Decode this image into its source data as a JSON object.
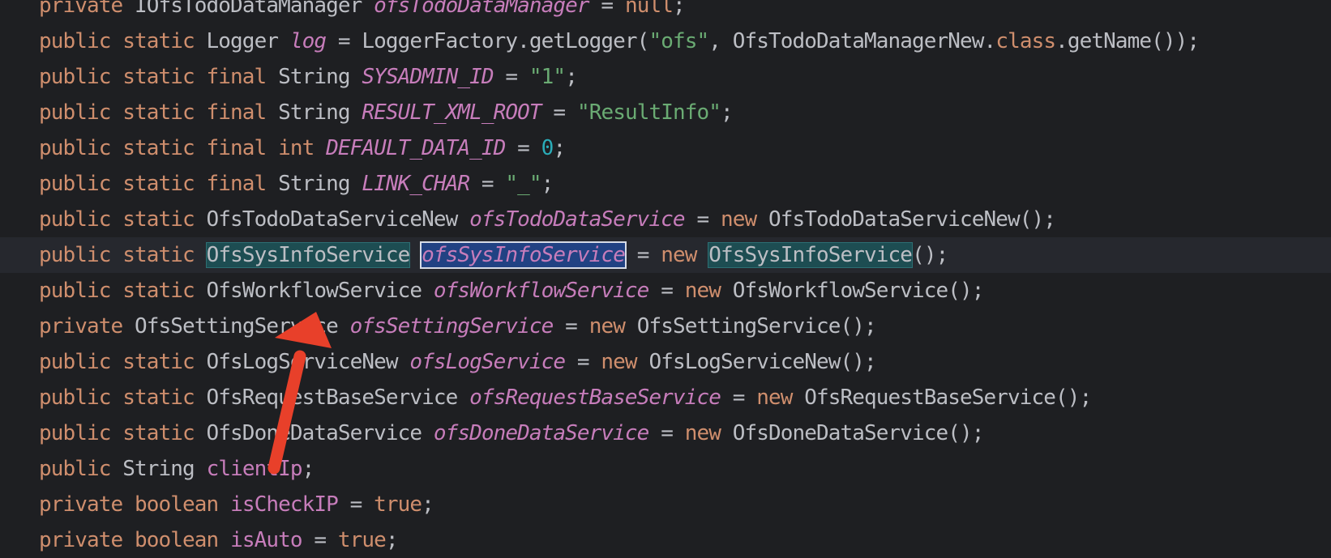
{
  "editor": {
    "lines": [
      {
        "segments": [
          {
            "t": "private",
            "c": "kw"
          },
          {
            "t": " IOfsTodoDataManager ",
            "c": "cls"
          },
          {
            "t": "ofsTodoDataManager",
            "c": "fld"
          },
          {
            "t": " = ",
            "c": "cls"
          },
          {
            "t": "null",
            "c": "kw"
          },
          {
            "t": ";",
            "c": "cls"
          }
        ]
      },
      {
        "segments": [
          {
            "t": "public static",
            "c": "kw"
          },
          {
            "t": " Logger ",
            "c": "cls"
          },
          {
            "t": "log",
            "c": "fld"
          },
          {
            "t": " = LoggerFactory.getLogger(",
            "c": "cls"
          },
          {
            "t": "\"ofs\"",
            "c": "str"
          },
          {
            "t": ", OfsTodoDataManagerNew.",
            "c": "cls"
          },
          {
            "t": "class",
            "c": "kw"
          },
          {
            "t": ".getName());",
            "c": "cls"
          }
        ]
      },
      {
        "segments": [
          {
            "t": "public static final",
            "c": "kw"
          },
          {
            "t": " String ",
            "c": "cls"
          },
          {
            "t": "SYSADMIN_ID",
            "c": "fld"
          },
          {
            "t": " = ",
            "c": "cls"
          },
          {
            "t": "\"1\"",
            "c": "str"
          },
          {
            "t": ";",
            "c": "cls"
          }
        ]
      },
      {
        "segments": [
          {
            "t": "public static final",
            "c": "kw"
          },
          {
            "t": " String ",
            "c": "cls"
          },
          {
            "t": "RESULT_XML_ROOT",
            "c": "fld"
          },
          {
            "t": " = ",
            "c": "cls"
          },
          {
            "t": "\"ResultInfo\"",
            "c": "str"
          },
          {
            "t": ";",
            "c": "cls"
          }
        ]
      },
      {
        "segments": [
          {
            "t": "public static final int",
            "c": "kw"
          },
          {
            "t": " ",
            "c": "cls"
          },
          {
            "t": "DEFAULT_DATA_ID",
            "c": "fld"
          },
          {
            "t": " = ",
            "c": "cls"
          },
          {
            "t": "0",
            "c": "num"
          },
          {
            "t": ";",
            "c": "cls"
          }
        ]
      },
      {
        "segments": [
          {
            "t": "public static final",
            "c": "kw"
          },
          {
            "t": " String ",
            "c": "cls"
          },
          {
            "t": "LINK_CHAR",
            "c": "fld"
          },
          {
            "t": " = ",
            "c": "cls"
          },
          {
            "t": "\"_\"",
            "c": "str"
          },
          {
            "t": ";",
            "c": "cls"
          }
        ]
      },
      {
        "segments": [
          {
            "t": "public static",
            "c": "kw"
          },
          {
            "t": " OfsTodoDataServiceNew ",
            "c": "cls"
          },
          {
            "t": "ofsTodoDataService",
            "c": "fld"
          },
          {
            "t": " = ",
            "c": "cls"
          },
          {
            "t": "new",
            "c": "kw"
          },
          {
            "t": " OfsTodoDataServiceNew();",
            "c": "cls"
          }
        ]
      },
      {
        "current": true,
        "segments": [
          {
            "t": "public static",
            "c": "kw"
          },
          {
            "t": " ",
            "c": "cls"
          },
          {
            "t": "OfsSysInfoService",
            "c": "cls",
            "h": "usage"
          },
          {
            "t": " ",
            "c": "cls"
          },
          {
            "t": "ofsSysInfoService",
            "c": "fld",
            "h": "sel"
          },
          {
            "t": " = ",
            "c": "cls"
          },
          {
            "t": "new",
            "c": "kw"
          },
          {
            "t": " ",
            "c": "cls"
          },
          {
            "t": "OfsSysInfoService",
            "c": "cls",
            "h": "usage"
          },
          {
            "t": "();",
            "c": "cls"
          }
        ]
      },
      {
        "segments": [
          {
            "t": "public static",
            "c": "kw"
          },
          {
            "t": " OfsWorkflowService ",
            "c": "cls"
          },
          {
            "t": "ofsWorkflowService",
            "c": "fld"
          },
          {
            "t": " = ",
            "c": "cls"
          },
          {
            "t": "new",
            "c": "kw"
          },
          {
            "t": " OfsWorkflowService();",
            "c": "cls"
          }
        ]
      },
      {
        "segments": [
          {
            "t": "private",
            "c": "kw"
          },
          {
            "t": " OfsSettingService ",
            "c": "cls"
          },
          {
            "t": "ofsSettingService",
            "c": "fld"
          },
          {
            "t": " = ",
            "c": "cls"
          },
          {
            "t": "new",
            "c": "kw"
          },
          {
            "t": " OfsSettingService();",
            "c": "cls"
          }
        ]
      },
      {
        "segments": [
          {
            "t": "public static",
            "c": "kw"
          },
          {
            "t": " OfsLogServiceNew ",
            "c": "cls"
          },
          {
            "t": "ofsLogService",
            "c": "fld"
          },
          {
            "t": " = ",
            "c": "cls"
          },
          {
            "t": "new",
            "c": "kw"
          },
          {
            "t": " OfsLogServiceNew();",
            "c": "cls"
          }
        ]
      },
      {
        "segments": [
          {
            "t": "public static",
            "c": "kw"
          },
          {
            "t": " OfsRequestBaseService ",
            "c": "cls"
          },
          {
            "t": "ofsRequestBaseService",
            "c": "fld"
          },
          {
            "t": " = ",
            "c": "cls"
          },
          {
            "t": "new",
            "c": "kw"
          },
          {
            "t": " OfsRequestBaseService();",
            "c": "cls"
          }
        ]
      },
      {
        "segments": [
          {
            "t": "public static",
            "c": "kw"
          },
          {
            "t": " OfsDoneDataService ",
            "c": "cls"
          },
          {
            "t": "ofsDoneDataService",
            "c": "fld"
          },
          {
            "t": " = ",
            "c": "cls"
          },
          {
            "t": "new",
            "c": "kw"
          },
          {
            "t": " OfsDoneDataService();",
            "c": "cls"
          }
        ]
      },
      {
        "segments": [
          {
            "t": "public",
            "c": "kw"
          },
          {
            "t": " String ",
            "c": "cls"
          },
          {
            "t": "clientIp",
            "c": "ifld"
          },
          {
            "t": ";",
            "c": "cls"
          }
        ]
      },
      {
        "segments": [
          {
            "t": "private boolean",
            "c": "kw"
          },
          {
            "t": " ",
            "c": "cls"
          },
          {
            "t": "isCheckIP",
            "c": "ifld"
          },
          {
            "t": " = ",
            "c": "cls"
          },
          {
            "t": "true",
            "c": "kw"
          },
          {
            "t": ";",
            "c": "cls"
          }
        ]
      },
      {
        "segments": [
          {
            "t": "private boolean",
            "c": "kw"
          },
          {
            "t": " ",
            "c": "cls"
          },
          {
            "t": "isAuto",
            "c": "ifld"
          },
          {
            "t": " = ",
            "c": "cls"
          },
          {
            "t": "true",
            "c": "kw"
          },
          {
            "t": ";",
            "c": "cls"
          }
        ]
      }
    ]
  },
  "annotation": {
    "icon": "red-arrow-icon",
    "color": "#e8402a"
  }
}
